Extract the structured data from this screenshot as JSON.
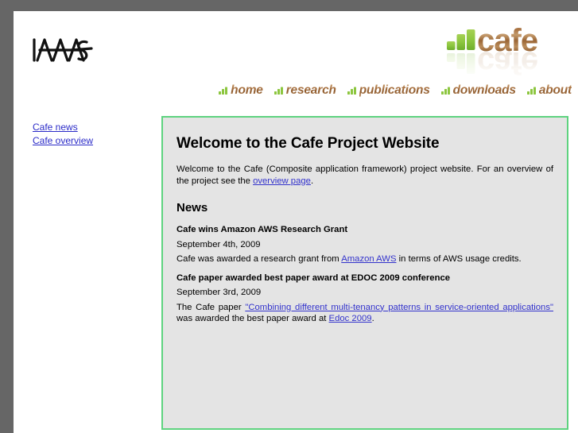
{
  "site": {
    "institute_logo_alt": "IAAS",
    "brand_logo_alt": "cafe"
  },
  "nav": {
    "items": [
      {
        "label": "home",
        "icon": "bar-chart-icon"
      },
      {
        "label": "research",
        "icon": "bar-chart-icon"
      },
      {
        "label": "publications",
        "icon": "bar-chart-icon"
      },
      {
        "label": "downloads",
        "icon": "bar-chart-icon"
      },
      {
        "label": "about",
        "icon": "bar-chart-icon"
      }
    ]
  },
  "sidebar": {
    "links": [
      {
        "label": "Cafe news"
      },
      {
        "label": "Cafe overview"
      }
    ]
  },
  "content": {
    "heading": "Welcome to the Cafe Project Website",
    "intro_before": "Welcome to the Cafe (Composite application framework) project website. For an overview of the project see the ",
    "intro_link": "overview page",
    "intro_after": ".",
    "news_heading": "News",
    "news": [
      {
        "title": "Cafe wins Amazon AWS Research Grant",
        "date": "September 4th, 2009",
        "body_before": "Cafe was awarded a research grant from ",
        "link": "Amazon AWS",
        "body_after": " in terms of AWS usage credits.",
        "body_before2": "",
        "link2": "",
        "body_after2": ""
      },
      {
        "title": "Cafe paper awarded best paper award at EDOC 2009 conference",
        "date": "September 3rd, 2009",
        "body_before": "The Cafe paper ",
        "link": "\"Combining different multi-tenancy patterns in service-oriented applications\"",
        "body_after": " was awarded the best paper award at ",
        "body_before2": "",
        "link2": "Edoc 2009",
        "body_after2": "."
      }
    ]
  },
  "colors": {
    "page_chrome": "#666666",
    "content_border": "#5ed37f",
    "content_background": "#e4e4e4",
    "link": "#3333cc",
    "nav_text": "#9d6b3f",
    "accent_green": "#8cc63f"
  }
}
